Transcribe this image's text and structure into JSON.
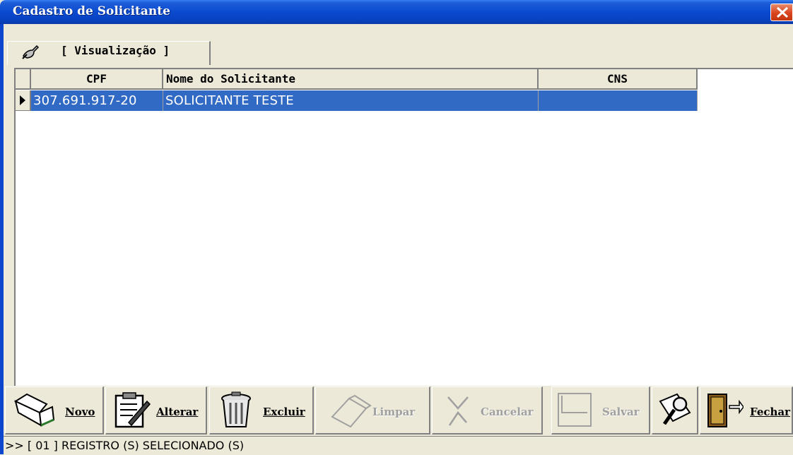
{
  "window": {
    "title": "Cadastro de Solicitante"
  },
  "tabs": [
    {
      "label": "[ Visualização ]",
      "icon": "brush-icon",
      "active": true
    }
  ],
  "grid": {
    "columns": [
      "CPF",
      "Nome do Solicitante",
      "CNS"
    ],
    "rows": [
      {
        "cpf": "307.691.917-20",
        "nome": "SOLICITANTE TESTE",
        "cns": ""
      }
    ],
    "selected_color": "#316ac5"
  },
  "toolbar": {
    "novo": "Novo",
    "alterar": "Alterar",
    "excluir": "Excluir",
    "limpar": "Limpar",
    "cancelar": "Cancelar",
    "salvar": "Salvar",
    "fechar": "Fechar"
  },
  "status": {
    "text": ">> [ 01 ] REGISTRO (S) SELECIONADO (S)"
  }
}
